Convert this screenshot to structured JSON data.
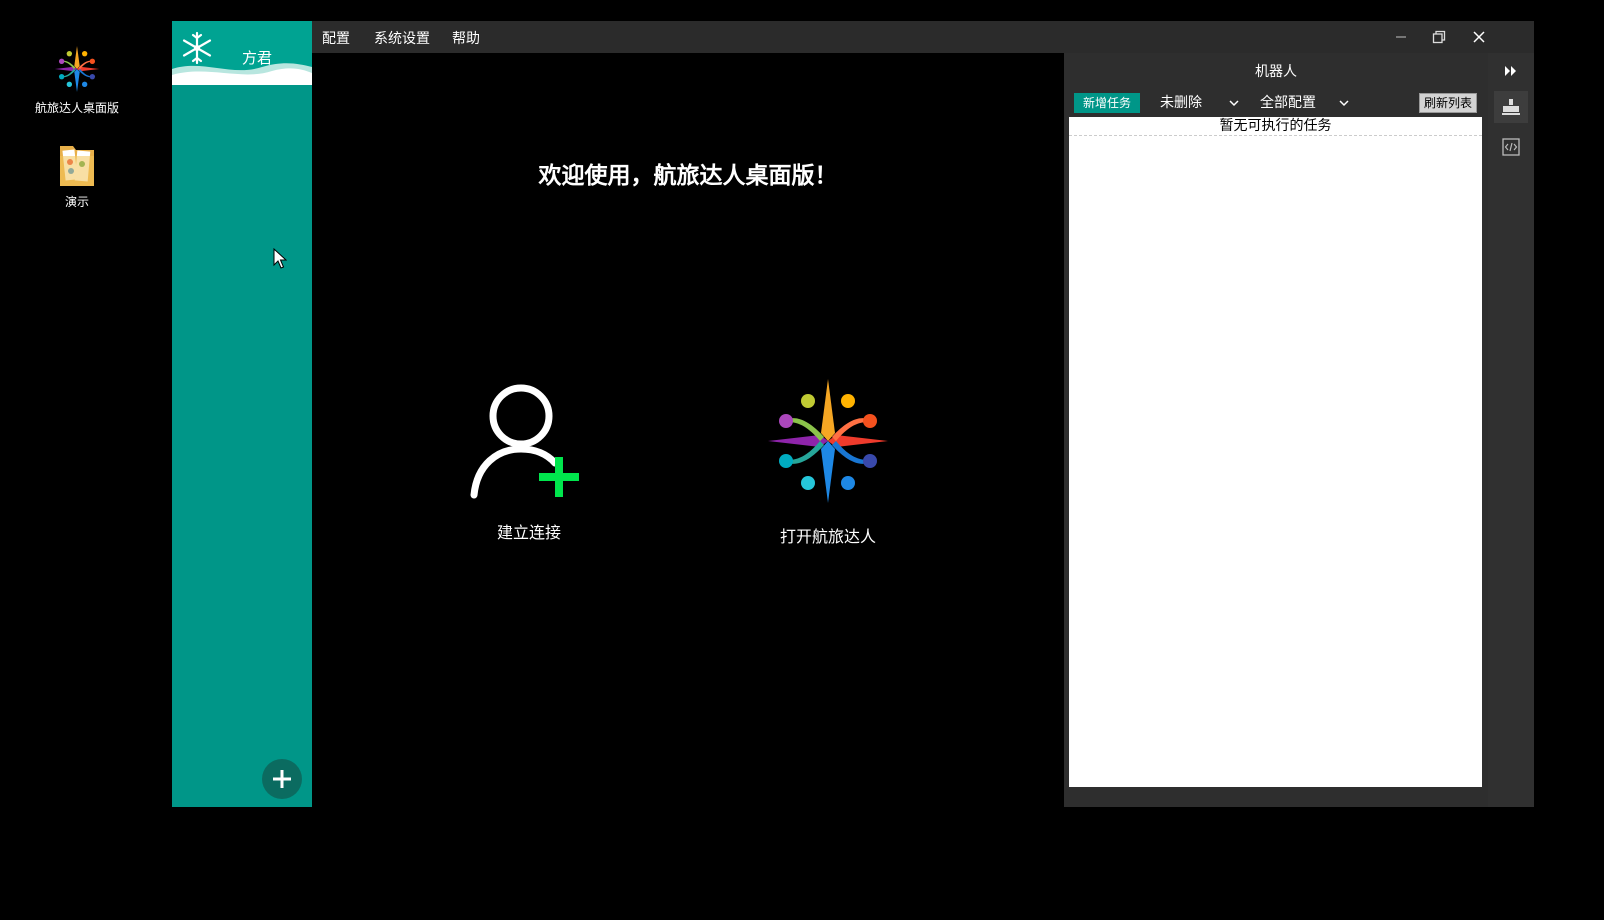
{
  "desktop": {
    "icons": [
      {
        "label": "航旅达人桌面版"
      },
      {
        "label": "演示"
      }
    ]
  },
  "sidebar": {
    "user_name": "方君",
    "add_icon": "plus-icon"
  },
  "menu": {
    "items": [
      "配置",
      "系统设置",
      "帮助"
    ]
  },
  "window_controls": {
    "minimize": "minimize-icon",
    "restore": "restore-icon",
    "close": "close-icon"
  },
  "main": {
    "welcome": "欢迎使用，航旅达人桌面版！",
    "actions": [
      {
        "label": "建立连接",
        "icon": "add-user-icon"
      },
      {
        "label": "打开航旅达人",
        "icon": "app-logo-icon"
      }
    ]
  },
  "robot_panel": {
    "title": "机器人",
    "new_task": "新增任务",
    "filter_status": "未删除",
    "filter_config": "全部配置",
    "refresh": "刷新列表",
    "empty_message": "暂无可执行的任务"
  },
  "colors": {
    "accent": "#009688",
    "add_green": "#00e64d"
  }
}
